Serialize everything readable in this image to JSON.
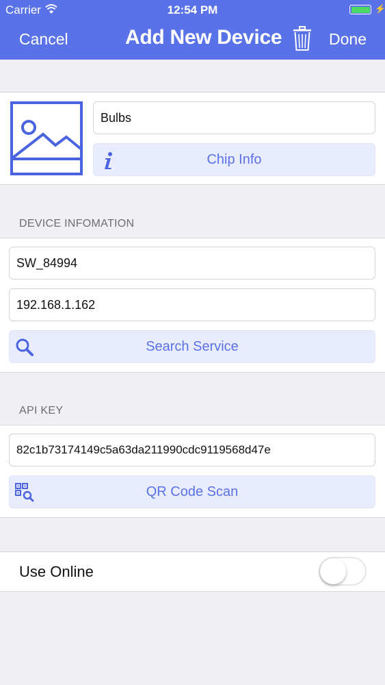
{
  "status_bar": {
    "carrier": "Carrier",
    "time": "12:54 PM",
    "battery_level": 1.0
  },
  "nav": {
    "cancel": "Cancel",
    "title": "Add New Device",
    "done": "Done"
  },
  "device": {
    "name": "Bulbs",
    "chip_info_label": "Chip Info"
  },
  "device_info": {
    "header": "DEVICE INFOMATION",
    "id": "SW_84994",
    "ip": "192.168.1.162",
    "search_label": "Search Service"
  },
  "api": {
    "header": "API KEY",
    "key": "82c1b73174149c5a63da211990cdc9119568d47e",
    "qr_label": "QR Code Scan"
  },
  "online": {
    "label": "Use Online",
    "enabled": false
  },
  "colors": {
    "accent": "#5a72e8",
    "button_bg": "#e8ecfc",
    "background": "#efeff4"
  }
}
